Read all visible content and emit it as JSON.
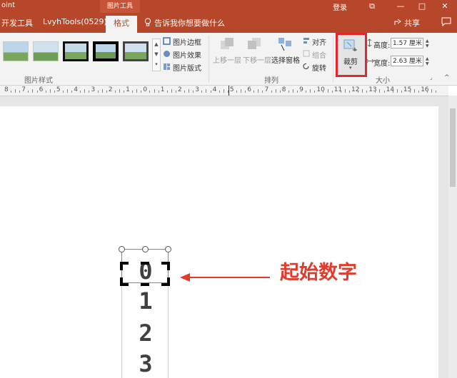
{
  "titlebar": {
    "app_title": "oint",
    "context_tab": "图片工具",
    "login": "登录",
    "controls": {
      "restore": "⧉",
      "minimize": "—",
      "maximize": "□",
      "close": "✕"
    }
  },
  "menubar": {
    "tabs": [
      "开发工具",
      "LvyhTools(0529)",
      "格式"
    ],
    "tell_me": "告诉我你想要做什么",
    "share": "共享"
  },
  "ribbon": {
    "picture_styles": {
      "label": "图片样式",
      "commands": [
        "图片边框",
        "图片效果",
        "图片版式"
      ]
    },
    "arrange": {
      "label": "排列",
      "bring_forward": "上移一层",
      "send_backward": "下移一层",
      "selection_pane": "选择窗格",
      "align": "对齐",
      "group": "组合",
      "rotate": "旋转"
    },
    "size": {
      "label": "大小",
      "crop": "裁剪",
      "height_label": "高度:",
      "height_value": "1.57 厘米",
      "width_label": "宽度:",
      "width_value": "2.63 厘米"
    }
  },
  "ruler": {
    "labels": [
      "8",
      "7",
      "6",
      "5",
      "4",
      "3",
      "2",
      "1",
      "0",
      "1",
      "2",
      "3",
      "4",
      "5",
      "6",
      "7",
      "8",
      "9",
      "10",
      "11",
      "12",
      "13",
      "14",
      "15",
      "16"
    ]
  },
  "slide": {
    "digits": [
      "0",
      "1",
      "2",
      "3"
    ],
    "annotation": "起始数字"
  },
  "colors": {
    "accent": "#b7472a",
    "highlight_red": "#e13b2c"
  }
}
